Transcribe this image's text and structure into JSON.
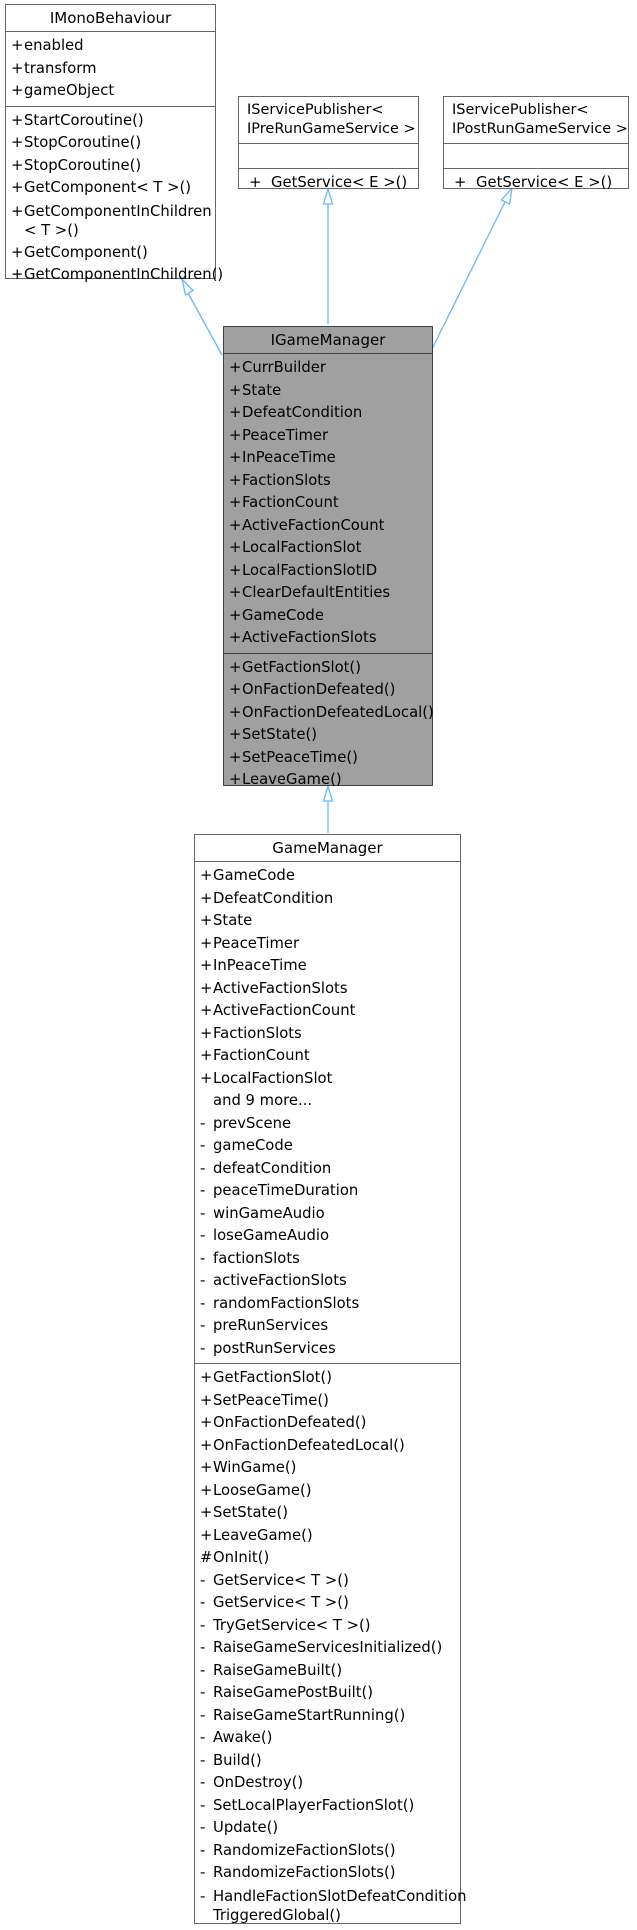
{
  "imono": {
    "title": "IMonoBehaviour",
    "attributes": [
      {
        "vis": "+",
        "name": "enabled"
      },
      {
        "vis": "+",
        "name": "transform"
      },
      {
        "vis": "+",
        "name": "gameObject"
      }
    ],
    "methods": [
      {
        "vis": "+",
        "name": "StartCoroutine()"
      },
      {
        "vis": "+",
        "name": "StopCoroutine()"
      },
      {
        "vis": "+",
        "name": "StopCoroutine()"
      },
      {
        "vis": "+",
        "name": "GetComponent< T >()"
      },
      {
        "vis": "+",
        "name": "GetComponentInChildren\n< T >()"
      },
      {
        "vis": "+",
        "name": "GetComponent()"
      },
      {
        "vis": "+",
        "name": "GetComponentInChildren()"
      }
    ]
  },
  "ipre": {
    "title_line1": "IServicePublisher<",
    "title_line2": "IPreRunGameService >",
    "method": {
      "vis": "+",
      "name": "GetService< E >()"
    }
  },
  "ipost": {
    "title_line1": "IServicePublisher<",
    "title_line2": "IPostRunGameService >",
    "method": {
      "vis": "+",
      "name": "GetService< E >()"
    }
  },
  "igm": {
    "title": "IGameManager",
    "attributes": [
      {
        "vis": "+",
        "name": "CurrBuilder"
      },
      {
        "vis": "+",
        "name": "State"
      },
      {
        "vis": "+",
        "name": "DefeatCondition"
      },
      {
        "vis": "+",
        "name": "PeaceTimer"
      },
      {
        "vis": "+",
        "name": "InPeaceTime"
      },
      {
        "vis": "+",
        "name": "FactionSlots"
      },
      {
        "vis": "+",
        "name": "FactionCount"
      },
      {
        "vis": "+",
        "name": "ActiveFactionCount"
      },
      {
        "vis": "+",
        "name": "LocalFactionSlot"
      },
      {
        "vis": "+",
        "name": "LocalFactionSlotID"
      },
      {
        "vis": "+",
        "name": "ClearDefaultEntities"
      },
      {
        "vis": "+",
        "name": "GameCode"
      },
      {
        "vis": "+",
        "name": "ActiveFactionSlots"
      }
    ],
    "methods": [
      {
        "vis": "+",
        "name": "GetFactionSlot()"
      },
      {
        "vis": "+",
        "name": "OnFactionDefeated()"
      },
      {
        "vis": "+",
        "name": "OnFactionDefeatedLocal()"
      },
      {
        "vis": "+",
        "name": "SetState()"
      },
      {
        "vis": "+",
        "name": "SetPeaceTime()"
      },
      {
        "vis": "+",
        "name": "LeaveGame()"
      }
    ]
  },
  "gm": {
    "title": "GameManager",
    "attributes": [
      {
        "vis": "+",
        "name": "GameCode"
      },
      {
        "vis": "+",
        "name": "DefeatCondition"
      },
      {
        "vis": "+",
        "name": "State"
      },
      {
        "vis": "+",
        "name": "PeaceTimer"
      },
      {
        "vis": "+",
        "name": "InPeaceTime"
      },
      {
        "vis": "+",
        "name": "ActiveFactionSlots"
      },
      {
        "vis": "+",
        "name": "ActiveFactionCount"
      },
      {
        "vis": "+",
        "name": "FactionSlots"
      },
      {
        "vis": "+",
        "name": "FactionCount"
      },
      {
        "vis": "+",
        "name": "LocalFactionSlot"
      },
      {
        "vis": "",
        "name": "and 9 more..."
      },
      {
        "vis": "-",
        "name": "prevScene"
      },
      {
        "vis": "-",
        "name": "gameCode"
      },
      {
        "vis": "-",
        "name": "defeatCondition"
      },
      {
        "vis": "-",
        "name": "peaceTimeDuration"
      },
      {
        "vis": "-",
        "name": "winGameAudio"
      },
      {
        "vis": "-",
        "name": "loseGameAudio"
      },
      {
        "vis": "-",
        "name": "factionSlots"
      },
      {
        "vis": "-",
        "name": "activeFactionSlots"
      },
      {
        "vis": "-",
        "name": "randomFactionSlots"
      },
      {
        "vis": "-",
        "name": "preRunServices"
      },
      {
        "vis": "-",
        "name": "postRunServices"
      }
    ],
    "methods": [
      {
        "vis": "+",
        "name": "GetFactionSlot()"
      },
      {
        "vis": "+",
        "name": "SetPeaceTime()"
      },
      {
        "vis": "+",
        "name": "OnFactionDefeated()"
      },
      {
        "vis": "+",
        "name": "OnFactionDefeatedLocal()"
      },
      {
        "vis": "+",
        "name": "WinGame()"
      },
      {
        "vis": "+",
        "name": "LooseGame()"
      },
      {
        "vis": "+",
        "name": "SetState()"
      },
      {
        "vis": "+",
        "name": "LeaveGame()"
      },
      {
        "vis": "#",
        "name": "OnInit()"
      },
      {
        "vis": "-",
        "name": "GetService< T >()"
      },
      {
        "vis": "-",
        "name": "GetService< T >()"
      },
      {
        "vis": "-",
        "name": "TryGetService< T >()"
      },
      {
        "vis": "-",
        "name": "RaiseGameServicesInitialized()"
      },
      {
        "vis": "-",
        "name": "RaiseGameBuilt()"
      },
      {
        "vis": "-",
        "name": "RaiseGamePostBuilt()"
      },
      {
        "vis": "-",
        "name": "RaiseGameStartRunning()"
      },
      {
        "vis": "-",
        "name": "Awake()"
      },
      {
        "vis": "-",
        "name": "Build()"
      },
      {
        "vis": "-",
        "name": "OnDestroy()"
      },
      {
        "vis": "-",
        "name": "SetLocalPlayerFactionSlot()"
      },
      {
        "vis": "-",
        "name": "Update()"
      },
      {
        "vis": "-",
        "name": "RandomizeFactionSlots()"
      },
      {
        "vis": "-",
        "name": "RandomizeFactionSlots()"
      },
      {
        "vis": "-",
        "name": "HandleFactionSlotDefeatCondition\nTriggeredGlobal()"
      }
    ]
  },
  "colors": {
    "edge": "#63b8ff",
    "border": "#666666",
    "highlight_fill": "#a0a0a0"
  }
}
